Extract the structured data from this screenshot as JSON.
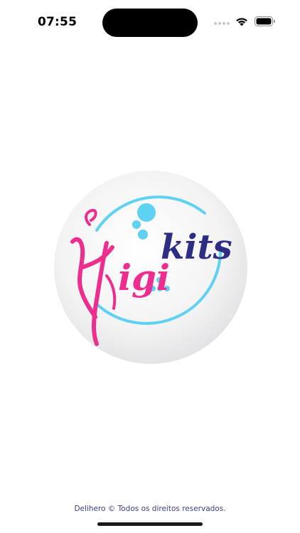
{
  "status_bar": {
    "time": "07:55",
    "icons": [
      "cellular-signal-icon",
      "wifi-icon",
      "battery-icon"
    ]
  },
  "logo": {
    "brand": "Higikits",
    "colors": {
      "pink": "#ee2e8f",
      "navy": "#2d2e83",
      "cyan": "#5fd1f1",
      "badge_bg": "#f2f2f3"
    }
  },
  "footer": {
    "copyright": "Delihero © Todos os direitos reservados."
  }
}
